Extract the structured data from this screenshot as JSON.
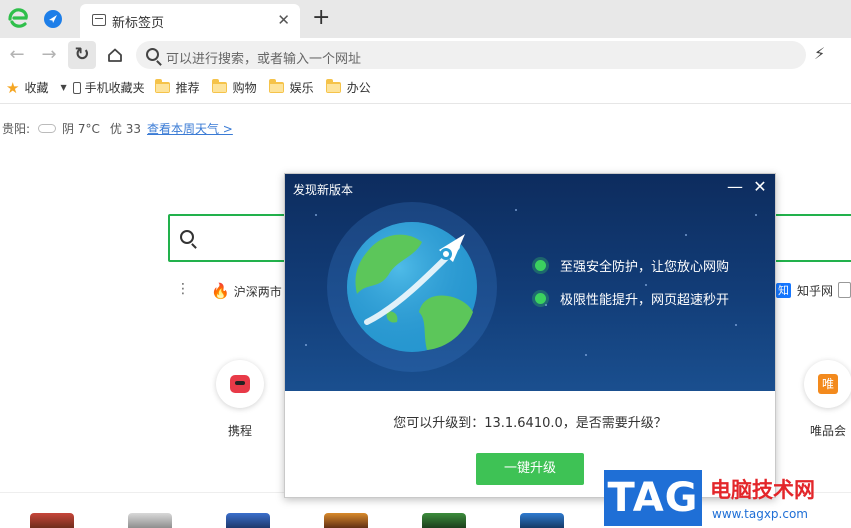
{
  "tab": {
    "title": "新标签页"
  },
  "address_bar": {
    "placeholder": "可以进行搜索，或者输入一个网址"
  },
  "bookmarks": [
    {
      "label": "收藏",
      "icon": "star-icon"
    },
    {
      "label": "手机收藏夹",
      "icon": "phone-icon"
    },
    {
      "label": "推荐",
      "icon": "folder-icon"
    },
    {
      "label": "购物",
      "icon": "folder-icon"
    },
    {
      "label": "娱乐",
      "icon": "folder-icon"
    },
    {
      "label": "办公",
      "icon": "folder-icon"
    }
  ],
  "weather": {
    "city": "贵阳:",
    "condition": "阴 7°C",
    "aqi": "优 33",
    "link": "查看本周天气 >"
  },
  "hot_topics": [
    {
      "label": "沪深两市",
      "icon": "fire-icon"
    },
    {
      "label": "知乎网",
      "icon": "zhihu-icon"
    }
  ],
  "sites": [
    {
      "label": "携程",
      "icon": "ctrip-icon"
    },
    {
      "label": "唯品会",
      "icon": "vip-icon",
      "mark": "唯"
    }
  ],
  "dialog": {
    "title": "发现新版本",
    "features": [
      "至强安全防护，让您放心网购",
      "极限性能提升，网页超速秒开"
    ],
    "message": "您可以升级到：13.1.6410.0，是否需要升级？",
    "button": "一键升级"
  },
  "watermark": {
    "tag": "TAG",
    "site_name": "电脑技术网",
    "url": "www.tagxp.com"
  },
  "colors": {
    "accent_green": "#22b14c",
    "dialog_banner": "#123d78",
    "button_green": "#3ec255",
    "link_blue": "#3a7bd5"
  }
}
